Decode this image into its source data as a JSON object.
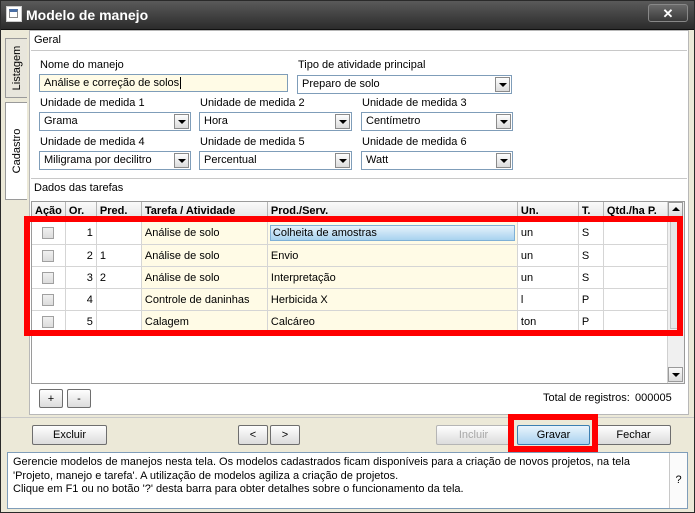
{
  "window": {
    "title": "Modelo de manejo",
    "close_label": "✕"
  },
  "side_tabs": [
    {
      "label": "Listagem"
    },
    {
      "label": "Cadastro"
    }
  ],
  "geral": {
    "section_title": "Geral",
    "nome_label": "Nome do manejo",
    "nome_value": "Análise e correção de solos",
    "tipo_label": "Tipo de atividade principal",
    "tipo_value": "Preparo de solo",
    "units": [
      {
        "label": "Unidade de medida 1",
        "value": "Grama"
      },
      {
        "label": "Unidade de medida 2",
        "value": "Hora"
      },
      {
        "label": "Unidade de medida 3",
        "value": "Centímetro"
      },
      {
        "label": "Unidade de medida 4",
        "value": "Miligrama por decilitro"
      },
      {
        "label": "Unidade de medida 5",
        "value": "Percentual"
      },
      {
        "label": "Unidade de medida 6",
        "value": "Watt"
      }
    ]
  },
  "tasks": {
    "section_title": "Dados das tarefas",
    "columns": [
      "Ação",
      "Or.",
      "Pred.",
      "Tarefa / Atividade",
      "Prod./Serv.",
      "Un.",
      "T.",
      "Qtd./ha P."
    ],
    "rows": [
      {
        "or": "1",
        "pred": "",
        "tarefa": "Análise de solo",
        "prod": "Colheita de amostras",
        "un": "un",
        "t": "S",
        "qtd": ""
      },
      {
        "or": "2",
        "pred": "1",
        "tarefa": "Análise de solo",
        "prod": "Envio",
        "un": "un",
        "t": "S",
        "qtd": ""
      },
      {
        "or": "3",
        "pred": "2",
        "tarefa": "Análise de solo",
        "prod": "Interpretação",
        "un": "un",
        "t": "S",
        "qtd": ""
      },
      {
        "or": "4",
        "pred": "",
        "tarefa": "Controle de daninhas",
        "prod": "Herbicida X",
        "un": "l",
        "t": "P",
        "qtd": ""
      },
      {
        "or": "5",
        "pred": "",
        "tarefa": "Calagem",
        "prod": "Calcáreo",
        "un": "ton",
        "t": "P",
        "qtd": ""
      }
    ],
    "add_label": "+",
    "remove_label": "-",
    "total_label": "Total de registros:",
    "total_value": "000005"
  },
  "buttons": {
    "excluir": "Excluir",
    "prev": "<",
    "next": ">",
    "incluir": "Incluir",
    "gravar": "Gravar",
    "fechar": "Fechar"
  },
  "help": {
    "lines": [
      "Gerencie modelos de manejos nesta tela. Os modelos cadastrados ficam disponíveis para a criação de novos projetos, na tela",
      "'Projeto, manejo e tarefa'. A utilização de modelos agiliza a criação de projetos.",
      "Clique em F1 ou no botão '?' desta barra para obter detalhes sobre o funcionamento da tela."
    ],
    "question_label": "?"
  },
  "colors": {
    "highlight": "#ff0000",
    "field_bg": "#fffbe6",
    "selected_cell": "#a8d2ef"
  }
}
